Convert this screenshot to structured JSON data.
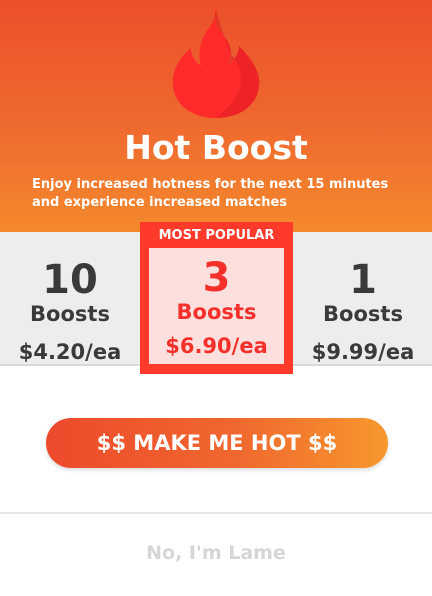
{
  "header": {
    "title": "Hot Boost",
    "subtitle": "Enjoy increased hotness for the next 15 minutes and experience increased matches",
    "flame_icon": "flame-icon",
    "flame_color": "#ff3a2b"
  },
  "options": [
    {
      "count": "10",
      "unit": "Boosts",
      "price": "$4.20/ea"
    },
    {
      "badge": "MOST POPULAR",
      "count": "3",
      "unit": "Boosts",
      "price": "$6.90/ea",
      "selected": true
    },
    {
      "count": "1",
      "unit": "Boosts",
      "price": "$9.99/ea"
    }
  ],
  "actions": {
    "primary_label": "$$ MAKE ME HOT $$",
    "dismiss_label": "No, I'm Lame"
  },
  "colors": {
    "accent": "#ff3a2b",
    "header_top": "#ec4f2c",
    "header_bottom": "#f4892d"
  }
}
